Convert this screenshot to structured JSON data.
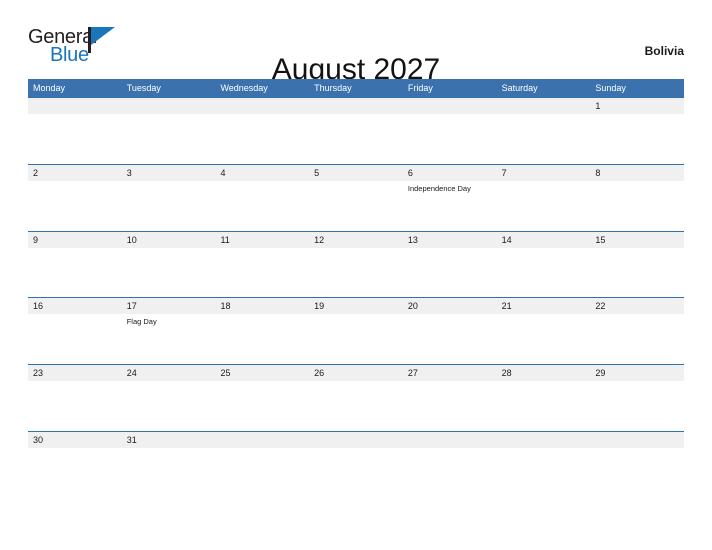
{
  "brand": {
    "word_one": "General",
    "word_two": "Blue",
    "flag_icon": "flag-triangle-icon",
    "primary_color": "#1b75bb"
  },
  "header": {
    "title": "August 2027",
    "country": "Bolivia"
  },
  "theme": {
    "header_blue": "#3b72ae",
    "divider_blue": "#2f72ad",
    "daystrip_gray": "#f0f0f0",
    "text_color": "#1a1a1a"
  },
  "calendar": {
    "weekdays": [
      "Monday",
      "Tuesday",
      "Wednesday",
      "Thursday",
      "Friday",
      "Saturday",
      "Sunday"
    ],
    "weeks": [
      {
        "days": [
          {
            "number": "",
            "event": ""
          },
          {
            "number": "",
            "event": ""
          },
          {
            "number": "",
            "event": ""
          },
          {
            "number": "",
            "event": ""
          },
          {
            "number": "",
            "event": ""
          },
          {
            "number": "",
            "event": ""
          },
          {
            "number": "1",
            "event": ""
          }
        ]
      },
      {
        "days": [
          {
            "number": "2",
            "event": ""
          },
          {
            "number": "3",
            "event": ""
          },
          {
            "number": "4",
            "event": ""
          },
          {
            "number": "5",
            "event": ""
          },
          {
            "number": "6",
            "event": "Independence Day"
          },
          {
            "number": "7",
            "event": ""
          },
          {
            "number": "8",
            "event": ""
          }
        ]
      },
      {
        "days": [
          {
            "number": "9",
            "event": ""
          },
          {
            "number": "10",
            "event": ""
          },
          {
            "number": "11",
            "event": ""
          },
          {
            "number": "12",
            "event": ""
          },
          {
            "number": "13",
            "event": ""
          },
          {
            "number": "14",
            "event": ""
          },
          {
            "number": "15",
            "event": ""
          }
        ]
      },
      {
        "days": [
          {
            "number": "16",
            "event": ""
          },
          {
            "number": "17",
            "event": "Flag Day"
          },
          {
            "number": "18",
            "event": ""
          },
          {
            "number": "19",
            "event": ""
          },
          {
            "number": "20",
            "event": ""
          },
          {
            "number": "21",
            "event": ""
          },
          {
            "number": "22",
            "event": ""
          }
        ]
      },
      {
        "days": [
          {
            "number": "23",
            "event": ""
          },
          {
            "number": "24",
            "event": ""
          },
          {
            "number": "25",
            "event": ""
          },
          {
            "number": "26",
            "event": ""
          },
          {
            "number": "27",
            "event": ""
          },
          {
            "number": "28",
            "event": ""
          },
          {
            "number": "29",
            "event": ""
          }
        ]
      },
      {
        "days": [
          {
            "number": "30",
            "event": ""
          },
          {
            "number": "31",
            "event": ""
          },
          {
            "number": "",
            "event": ""
          },
          {
            "number": "",
            "event": ""
          },
          {
            "number": "",
            "event": ""
          },
          {
            "number": "",
            "event": ""
          },
          {
            "number": "",
            "event": ""
          }
        ]
      }
    ]
  }
}
